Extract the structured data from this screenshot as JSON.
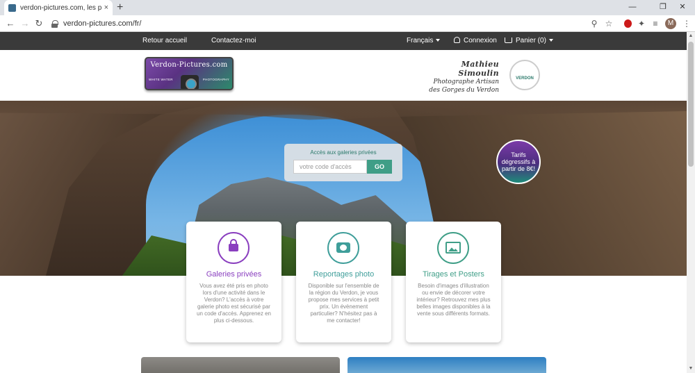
{
  "browser": {
    "tab_title": "verdon-pictures.com, les photos",
    "tab_close": "×",
    "new_tab": "+",
    "url": "verdon-pictures.com/fr/",
    "avatar_letter": "M",
    "back": "←",
    "forward": "→",
    "reload": "↻",
    "zoom": "⚲",
    "star": "☆",
    "extensions": "✦",
    "media": "≡",
    "menu": "⋮",
    "minimize": "—",
    "restore": "❐",
    "close": "✕"
  },
  "nav": {
    "home": "Retour accueil",
    "contact": "Contactez-moi",
    "language": "Français",
    "login": "Connexion",
    "cart": "Panier (0)"
  },
  "header": {
    "logo_title": "Verdon-Pictures.com",
    "logo_left": "White Water",
    "logo_right": "Photography",
    "signature_name": "Mathieu Simoulin",
    "signature_line1": "Photographe Artisan",
    "signature_line2": "des Gorges du Verdon",
    "badge": "VERDON"
  },
  "search": {
    "label": "Accès aux galeries privées",
    "placeholder": "votre code d'accès",
    "button": "GO"
  },
  "promo": "Tarifs dégressifs à partir de 8€!",
  "cards": [
    {
      "title": "Galeries privées",
      "color": "#8a3fbf",
      "icon": "lock-icon",
      "text": "Vous avez été pris en photo lors d'une activité dans le Verdon? L'accès à votre galerie photo est sécurisé par un code d'accès. Apprenez en plus ci-dessous."
    },
    {
      "title": "Reportages photo",
      "color": "#3f9e9a",
      "icon": "camera-icon",
      "text": "Disponible sur l'ensemble de la région du Verdon, je vous propose mes services à petit prix. Un évènement particulier? N'hésitez pas à me contacter!"
    },
    {
      "title": "Tirages et Posters",
      "color": "#3f9e87",
      "icon": "image-icon",
      "text": "Besoin d'images d'illustration ou envie de décorer votre intérieur? Retrouvez mes plus belles images disponibles à la vente sous différents formats."
    }
  ]
}
